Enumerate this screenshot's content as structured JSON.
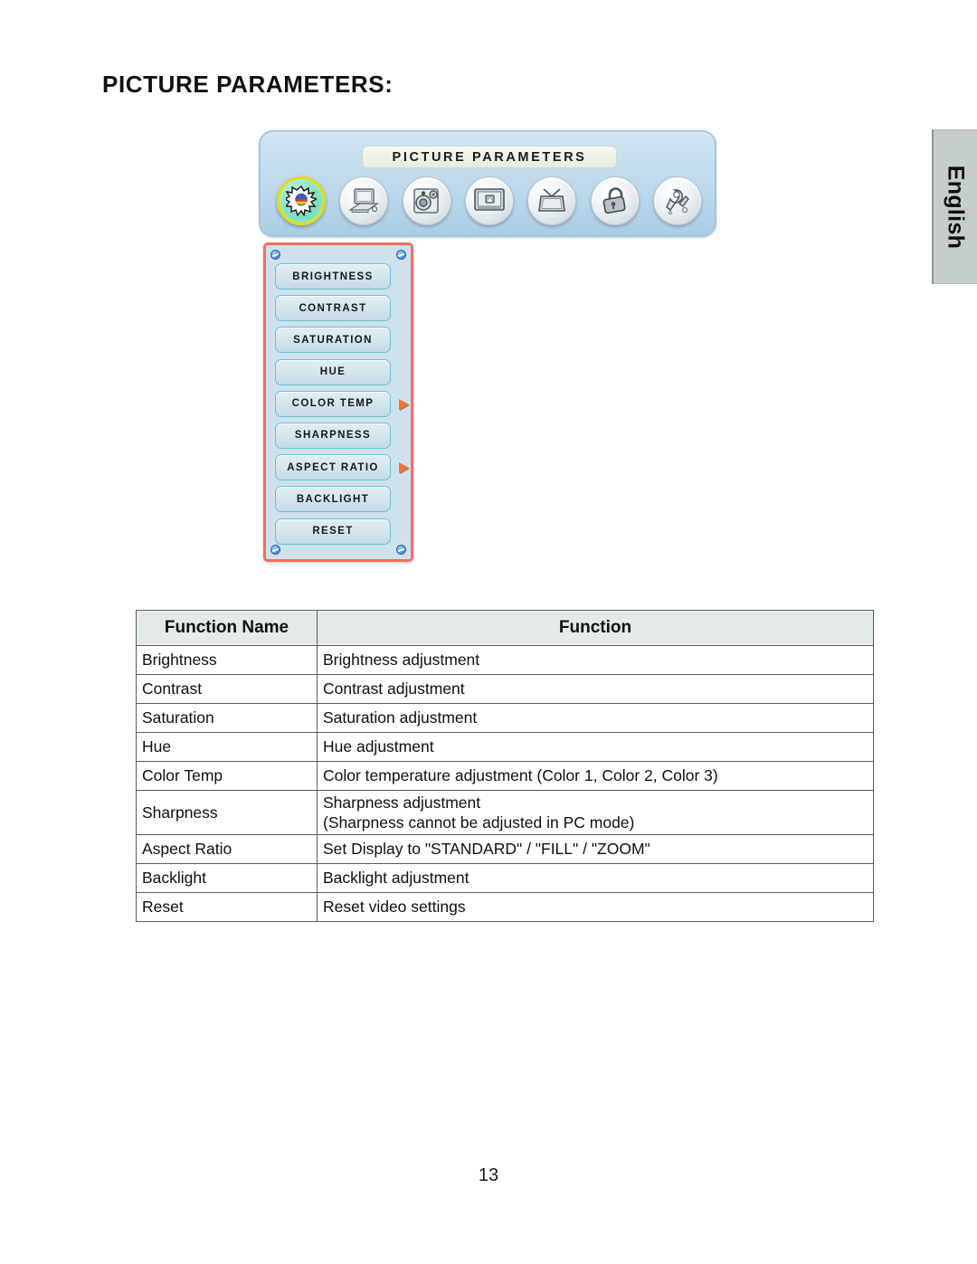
{
  "page": {
    "title": "PICTURE PARAMETERS:",
    "number": "13",
    "language_tab": "English"
  },
  "osd": {
    "menu_title": "PICTURE PARAMETERS",
    "icons": [
      {
        "name": "picture-parameters-icon",
        "label": "Picture Parameters",
        "active": true
      },
      {
        "name": "pc-settings-icon",
        "label": "PC Settings",
        "active": false
      },
      {
        "name": "audio-settings-icon",
        "label": "Audio Settings",
        "active": false
      },
      {
        "name": "osd-settings-icon",
        "label": "OSD Settings",
        "active": false
      },
      {
        "name": "tv-settings-icon",
        "label": "TV Settings",
        "active": false
      },
      {
        "name": "parental-lock-icon",
        "label": "Parental Lock",
        "active": false
      },
      {
        "name": "setup-tools-icon",
        "label": "Setup",
        "active": false
      }
    ],
    "submenu": [
      {
        "label": "BRIGHTNESS",
        "arrow": false
      },
      {
        "label": "CONTRAST",
        "arrow": false
      },
      {
        "label": "SATURATION",
        "arrow": false
      },
      {
        "label": "HUE",
        "arrow": false
      },
      {
        "label": "COLOR TEMP",
        "arrow": true
      },
      {
        "label": "SHARPNESS",
        "arrow": false
      },
      {
        "label": "ASPECT RATIO",
        "arrow": true
      },
      {
        "label": "BACKLIGHT",
        "arrow": false
      },
      {
        "label": "RESET",
        "arrow": false
      }
    ]
  },
  "table": {
    "headers": [
      "Function Name",
      "Function"
    ],
    "rows": [
      {
        "name": "Brightness",
        "function": [
          "Brightness adjustment"
        ]
      },
      {
        "name": "Contrast",
        "function": [
          "Contrast adjustment"
        ]
      },
      {
        "name": "Saturation",
        "function": [
          "Saturation adjustment"
        ]
      },
      {
        "name": "Hue",
        "function": [
          "Hue adjustment"
        ]
      },
      {
        "name": "Color Temp",
        "function": [
          "Color temperature adjustment (Color 1, Color 2, Color 3)"
        ]
      },
      {
        "name": "Sharpness",
        "function": [
          "Sharpness adjustment",
          "(Sharpness cannot be adjusted in PC mode)"
        ]
      },
      {
        "name": "Aspect Ratio",
        "function": [
          "Set Display to \"STANDARD\" / \"FILL\" / \"ZOOM\""
        ]
      },
      {
        "name": "Backlight",
        "function": [
          "Backlight adjustment"
        ]
      },
      {
        "name": "Reset",
        "function": [
          "Reset video settings"
        ]
      }
    ]
  },
  "colors": {
    "osd_panel": "#c3dcee",
    "submenu_border": "#f47060",
    "menu_button_border": "#67c2d8",
    "arrow": "#f2772a",
    "active_icon_ring": "#e4e000",
    "table_header_bg": "#e4e9e9",
    "language_tab_bg": "#c6cdcd"
  }
}
